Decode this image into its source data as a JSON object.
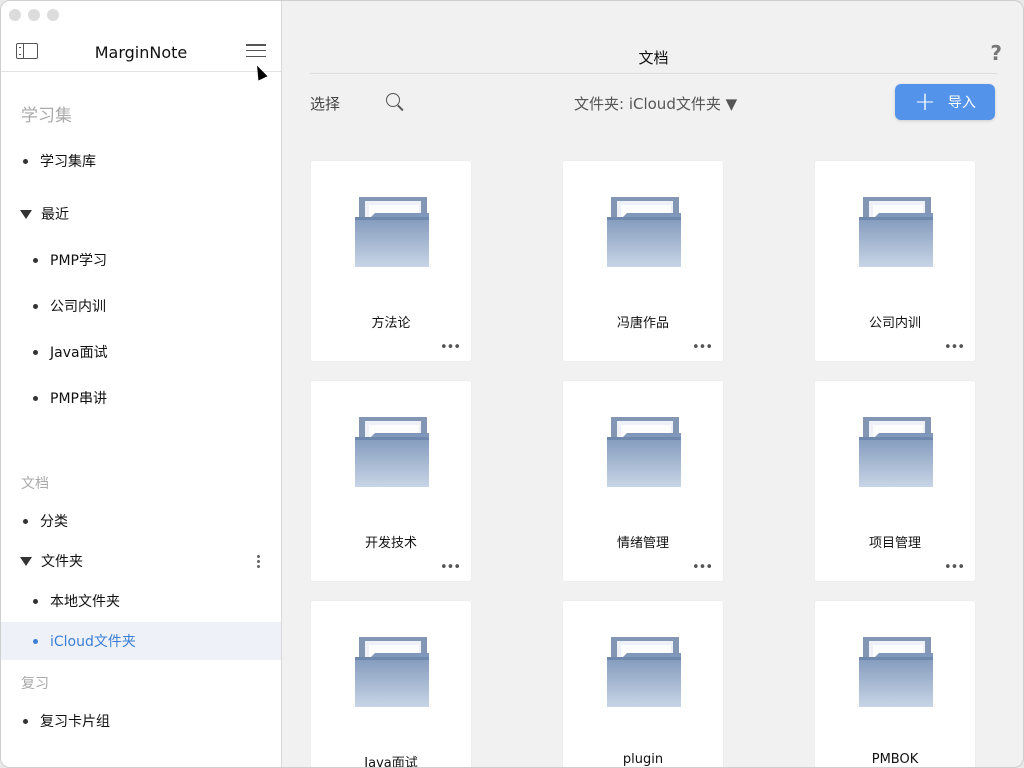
{
  "app": {
    "title": "MarginNote"
  },
  "sidebar": {
    "sections": {
      "study_sets": "学习集",
      "documents": "文档",
      "review": "复习"
    },
    "items": {
      "library": "学习集库",
      "recent": "最近",
      "recent_children": [
        "PMP学习",
        "公司内训",
        "Java面试",
        "PMP串讲"
      ],
      "categories": "分类",
      "folders": "文件夹",
      "local_folder": "本地文件夹",
      "icloud_folder": "iCloud文件夹",
      "review_decks": "复习卡片组"
    },
    "selected": "iCloud文件夹"
  },
  "main": {
    "title": "文档",
    "help_label": "?",
    "select_label": "选择",
    "folder_dropdown": "文件夹: iCloud文件夹 ▼",
    "import_label": "导入",
    "folders": [
      "方法论",
      "冯唐作品",
      "公司内训",
      "开发技术",
      "情绪管理",
      "项目管理",
      "Java面试",
      "plugin",
      "PMBOK"
    ],
    "more_label": "•••"
  },
  "colors": {
    "accent": "#5493ea",
    "selected_text": "#3a7fd5",
    "selected_bg": "#eef2f8"
  }
}
